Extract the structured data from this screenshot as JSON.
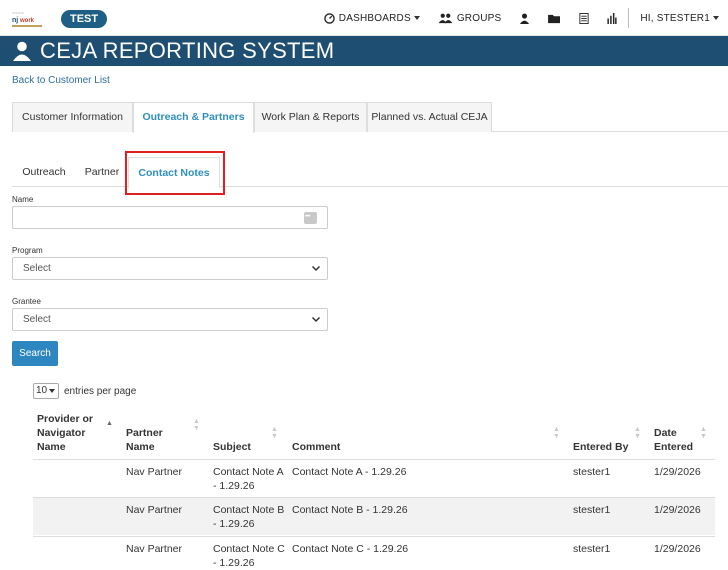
{
  "brand": {
    "badge": "TEST"
  },
  "topnav": {
    "dashboards": "DASHBOARDS",
    "groups": "GROUPS",
    "user_greeting": "HI, STESTER1"
  },
  "title": "CEJA REPORTING SYSTEM",
  "back_link": "Back to Customer List",
  "main_tabs": [
    {
      "label": "Customer Information"
    },
    {
      "label": "Outreach & Partners"
    },
    {
      "label": "Work Plan & Reports"
    },
    {
      "label": "Planned vs. Actual CEJA"
    }
  ],
  "main_tabs_active_index": 1,
  "sub_tabs": [
    {
      "label": "Outreach"
    },
    {
      "label": "Partner"
    },
    {
      "label": "Contact Notes"
    }
  ],
  "sub_tabs_active_index": 2,
  "form": {
    "name_label": "Name",
    "name_value": "",
    "program_label": "Program",
    "program_value": "Select",
    "grantee_label": "Grantee",
    "grantee_value": "Select",
    "search_label": "Search"
  },
  "page_length": {
    "value": "10",
    "suffix": "entries per page"
  },
  "table": {
    "headers": {
      "provider": [
        "Provider or",
        "Navigator",
        "Name"
      ],
      "partner": [
        "Partner",
        "Name"
      ],
      "subject": "Subject",
      "comment": "Comment",
      "entered_by": "Entered By",
      "date_entered": [
        "Date",
        "Entered"
      ]
    },
    "sort_ascending_column": "provider",
    "rows": [
      {
        "provider": "",
        "partner": "Nav Partner",
        "subject_line1": "Contact Note A",
        "subject_line2": "- 1.29.26",
        "comment": "Contact Note A - 1.29.26",
        "entered_by": "stester1",
        "date_entered": "1/29/2026"
      },
      {
        "provider": "",
        "partner": "Nav Partner",
        "subject_line1": "Contact Note B",
        "subject_line2": "- 1.29.26",
        "comment": "Contact Note B - 1.29.26",
        "entered_by": "stester1",
        "date_entered": "1/29/2026"
      },
      {
        "provider": "",
        "partner": "Nav Partner",
        "subject_line1": "Contact Note C",
        "subject_line2": "- 1.29.26",
        "comment": "Contact Note C - 1.29.26",
        "entered_by": "stester1",
        "date_entered": "1/29/2026"
      }
    ]
  },
  "colors": {
    "title_bar": "#1e4e71",
    "active_tab_text": "#2f8fbf",
    "primary_button": "#2e86c1",
    "highlight_border": "#e02020",
    "badge": "#1f5f86"
  },
  "icons": [
    "user-icon",
    "dashboard-icon",
    "groups-icon",
    "folder-icon",
    "list-icon",
    "chart-icon",
    "ellipsis-icon",
    "chevron-down-icon",
    "sort-icon"
  ]
}
